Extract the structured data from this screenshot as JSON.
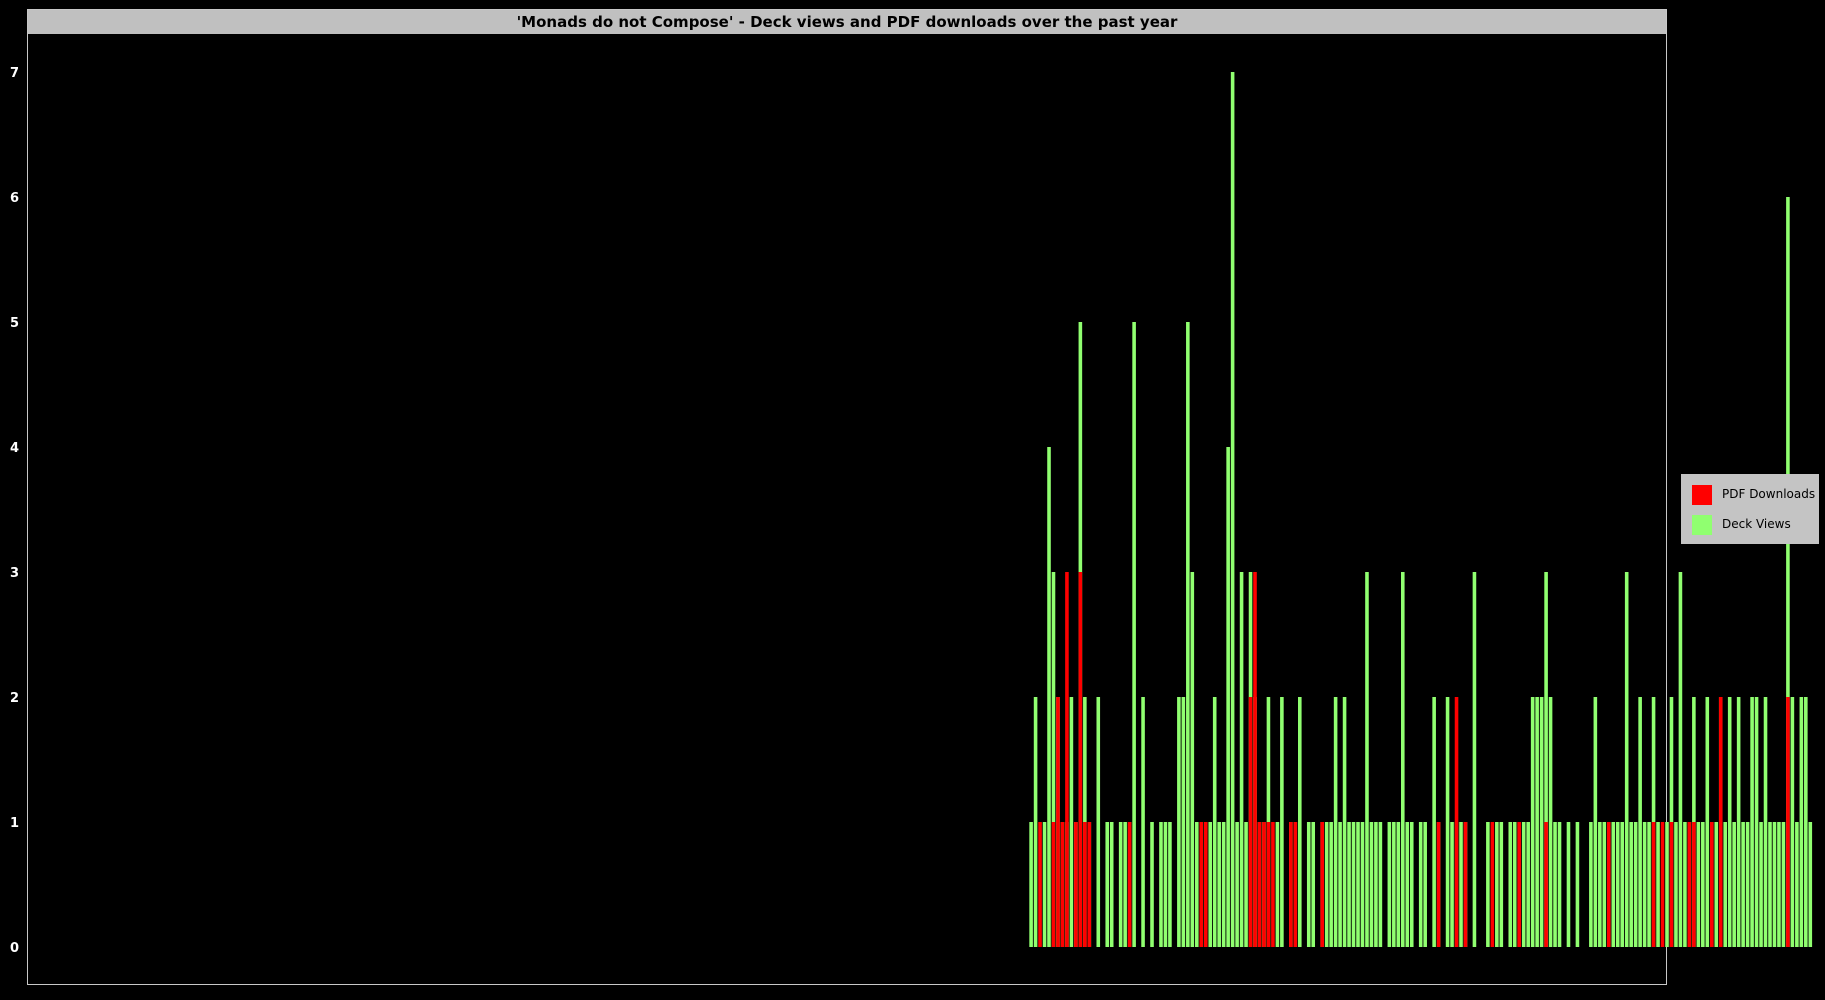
{
  "chart_data": {
    "type": "bar",
    "title": "'Monads do not Compose' - Deck views and PDF downloads over the past year",
    "xlabel": "",
    "ylabel": "",
    "ylim": [
      0,
      7
    ],
    "yticks": [
      "0",
      "1",
      "2",
      "3",
      "4",
      "5",
      "6",
      "7"
    ],
    "grid": false,
    "legend_position": "right",
    "day_count": 365,
    "series": [
      {
        "name": "PDF Downloads",
        "color": "#ff0000",
        "points": [
          [
            226,
            1
          ],
          [
            229,
            1
          ],
          [
            230,
            2
          ],
          [
            231,
            1
          ],
          [
            232,
            3
          ],
          [
            234,
            1
          ],
          [
            235,
            3
          ],
          [
            236,
            1
          ],
          [
            237,
            1
          ],
          [
            246,
            1
          ],
          [
            262,
            1
          ],
          [
            263,
            1
          ],
          [
            273,
            2
          ],
          [
            274,
            3
          ],
          [
            275,
            1
          ],
          [
            276,
            1
          ],
          [
            277,
            1
          ],
          [
            278,
            1
          ],
          [
            282,
            1
          ],
          [
            283,
            1
          ],
          [
            289,
            1
          ],
          [
            315,
            1
          ],
          [
            319,
            2
          ],
          [
            321,
            1
          ],
          [
            327,
            1
          ],
          [
            333,
            1
          ],
          [
            339,
            1
          ],
          [
            353,
            1
          ],
          [
            363,
            1
          ],
          [
            365,
            1
          ],
          [
            367,
            1
          ],
          [
            371,
            1
          ],
          [
            372,
            1
          ],
          [
            376,
            1
          ],
          [
            378,
            2
          ],
          [
            393,
            2
          ]
        ]
      },
      {
        "name": "Deck Views",
        "color": "#90ff70",
        "points": [
          [
            224,
            1
          ],
          [
            225,
            2
          ],
          [
            227,
            1
          ],
          [
            228,
            4
          ],
          [
            229,
            3
          ],
          [
            230,
            2
          ],
          [
            231,
            1
          ],
          [
            232,
            1
          ],
          [
            233,
            2
          ],
          [
            234,
            1
          ],
          [
            235,
            5
          ],
          [
            236,
            2
          ],
          [
            237,
            1
          ],
          [
            239,
            2
          ],
          [
            241,
            1
          ],
          [
            242,
            1
          ],
          [
            244,
            1
          ],
          [
            245,
            1
          ],
          [
            246,
            1
          ],
          [
            247,
            5
          ],
          [
            249,
            2
          ],
          [
            251,
            1
          ],
          [
            253,
            1
          ],
          [
            254,
            1
          ],
          [
            255,
            1
          ],
          [
            257,
            2
          ],
          [
            258,
            2
          ],
          [
            259,
            5
          ],
          [
            260,
            3
          ],
          [
            261,
            1
          ],
          [
            262,
            1
          ],
          [
            263,
            1
          ],
          [
            264,
            1
          ],
          [
            265,
            2
          ],
          [
            266,
            1
          ],
          [
            267,
            1
          ],
          [
            268,
            4
          ],
          [
            269,
            7
          ],
          [
            270,
            1
          ],
          [
            271,
            3
          ],
          [
            272,
            1
          ],
          [
            273,
            3
          ],
          [
            274,
            2
          ],
          [
            275,
            1
          ],
          [
            276,
            1
          ],
          [
            277,
            2
          ],
          [
            279,
            1
          ],
          [
            280,
            2
          ],
          [
            282,
            1
          ],
          [
            283,
            1
          ],
          [
            284,
            2
          ],
          [
            286,
            1
          ],
          [
            287,
            1
          ],
          [
            289,
            1
          ],
          [
            290,
            1
          ],
          [
            291,
            1
          ],
          [
            292,
            2
          ],
          [
            293,
            1
          ],
          [
            294,
            2
          ],
          [
            295,
            1
          ],
          [
            296,
            1
          ],
          [
            297,
            1
          ],
          [
            298,
            1
          ],
          [
            299,
            3
          ],
          [
            300,
            1
          ],
          [
            301,
            1
          ],
          [
            302,
            1
          ],
          [
            304,
            1
          ],
          [
            305,
            1
          ],
          [
            306,
            1
          ],
          [
            307,
            3
          ],
          [
            308,
            1
          ],
          [
            309,
            1
          ],
          [
            311,
            1
          ],
          [
            312,
            1
          ],
          [
            314,
            2
          ],
          [
            315,
            1
          ],
          [
            317,
            2
          ],
          [
            318,
            1
          ],
          [
            319,
            1
          ],
          [
            320,
            1
          ],
          [
            321,
            1
          ],
          [
            323,
            3
          ],
          [
            326,
            1
          ],
          [
            328,
            1
          ],
          [
            329,
            1
          ],
          [
            331,
            1
          ],
          [
            332,
            1
          ],
          [
            333,
            1
          ],
          [
            334,
            1
          ],
          [
            335,
            1
          ],
          [
            336,
            2
          ],
          [
            337,
            2
          ],
          [
            338,
            2
          ],
          [
            339,
            3
          ],
          [
            340,
            2
          ],
          [
            341,
            1
          ],
          [
            342,
            1
          ],
          [
            344,
            1
          ],
          [
            346,
            1
          ],
          [
            349,
            1
          ],
          [
            350,
            2
          ],
          [
            351,
            1
          ],
          [
            352,
            1
          ],
          [
            353,
            1
          ],
          [
            354,
            1
          ],
          [
            355,
            1
          ],
          [
            356,
            1
          ],
          [
            357,
            3
          ],
          [
            358,
            1
          ],
          [
            359,
            1
          ],
          [
            360,
            2
          ],
          [
            361,
            1
          ],
          [
            362,
            1
          ],
          [
            363,
            2
          ],
          [
            364,
            1
          ],
          [
            366,
            1
          ],
          [
            367,
            2
          ],
          [
            368,
            1
          ],
          [
            369,
            3
          ],
          [
            370,
            1
          ],
          [
            371,
            1
          ],
          [
            372,
            2
          ],
          [
            373,
            1
          ],
          [
            374,
            1
          ],
          [
            375,
            2
          ],
          [
            376,
            1
          ],
          [
            377,
            1
          ],
          [
            378,
            2
          ],
          [
            379,
            1
          ],
          [
            380,
            2
          ],
          [
            381,
            1
          ],
          [
            382,
            2
          ],
          [
            383,
            1
          ],
          [
            384,
            1
          ],
          [
            385,
            2
          ],
          [
            386,
            2
          ],
          [
            387,
            1
          ],
          [
            388,
            2
          ],
          [
            389,
            1
          ],
          [
            390,
            1
          ],
          [
            391,
            1
          ],
          [
            392,
            1
          ],
          [
            393,
            6
          ],
          [
            394,
            2
          ],
          [
            395,
            1
          ],
          [
            396,
            2
          ],
          [
            397,
            2
          ],
          [
            398,
            1
          ]
        ]
      }
    ]
  },
  "legend": {
    "items": [
      {
        "label": "PDF Downloads",
        "color": "#ff0000"
      },
      {
        "label": "Deck Views",
        "color": "#90ff70"
      }
    ]
  }
}
